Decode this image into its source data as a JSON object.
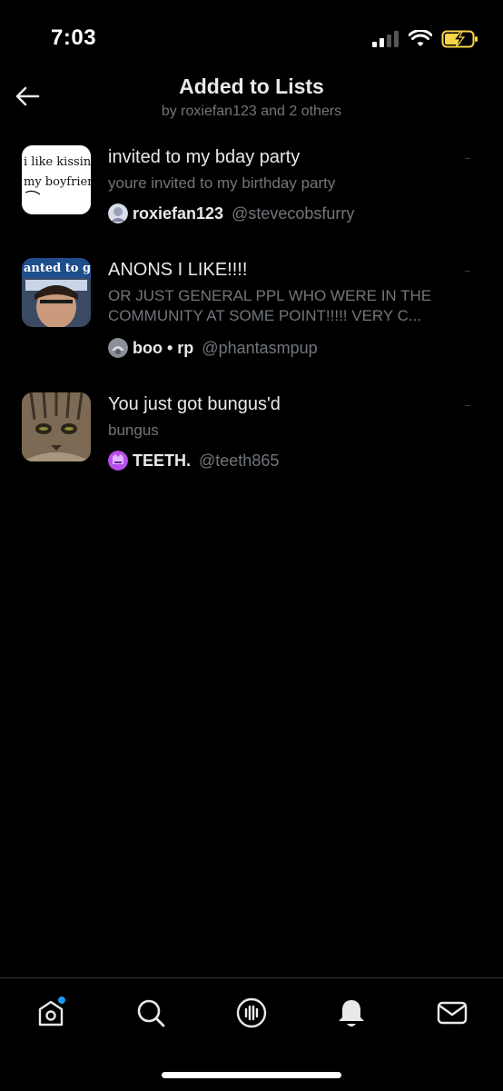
{
  "status_bar": {
    "time": "7:03",
    "icons": [
      "signal-icon",
      "wifi-icon",
      "battery-charging-icon"
    ]
  },
  "header": {
    "back_icon": "back-arrow-icon",
    "title": "Added to Lists",
    "subtitle": "by roxiefan123 and 2 others"
  },
  "lists": [
    {
      "thumb_text": [
        "i like kissing",
        "my boyfrien"
      ],
      "title": "invited to my bday party",
      "description": "youre invited to my birthday party",
      "owner_name": "roxiefan123",
      "owner_handle": "@stevecobsfurry"
    },
    {
      "thumb_text": [
        "anted to g"
      ],
      "title": "ANONS I LIKE!!!!",
      "description": "OR JUST GENERAL PPL WHO WERE IN THE COMMUNITY AT SOME POINT!!!!! VERY C...",
      "owner_name": "boo • rp",
      "owner_handle": "@phantasmpup"
    },
    {
      "thumb_text": [],
      "title": "You just got bungus'd",
      "description": "bungus",
      "owner_name": "TEETH.",
      "owner_handle": "@teeth865"
    }
  ],
  "tab_bar": {
    "tabs": [
      "home-icon",
      "search-icon",
      "spaces-icon",
      "notifications-icon",
      "messages-icon"
    ],
    "home_has_dot": true
  },
  "colors": {
    "background": "#000000",
    "primary_text": "#e7e9ea",
    "secondary_text": "#71767b",
    "accent": "#1d9bf0",
    "battery": "#f5d547"
  }
}
